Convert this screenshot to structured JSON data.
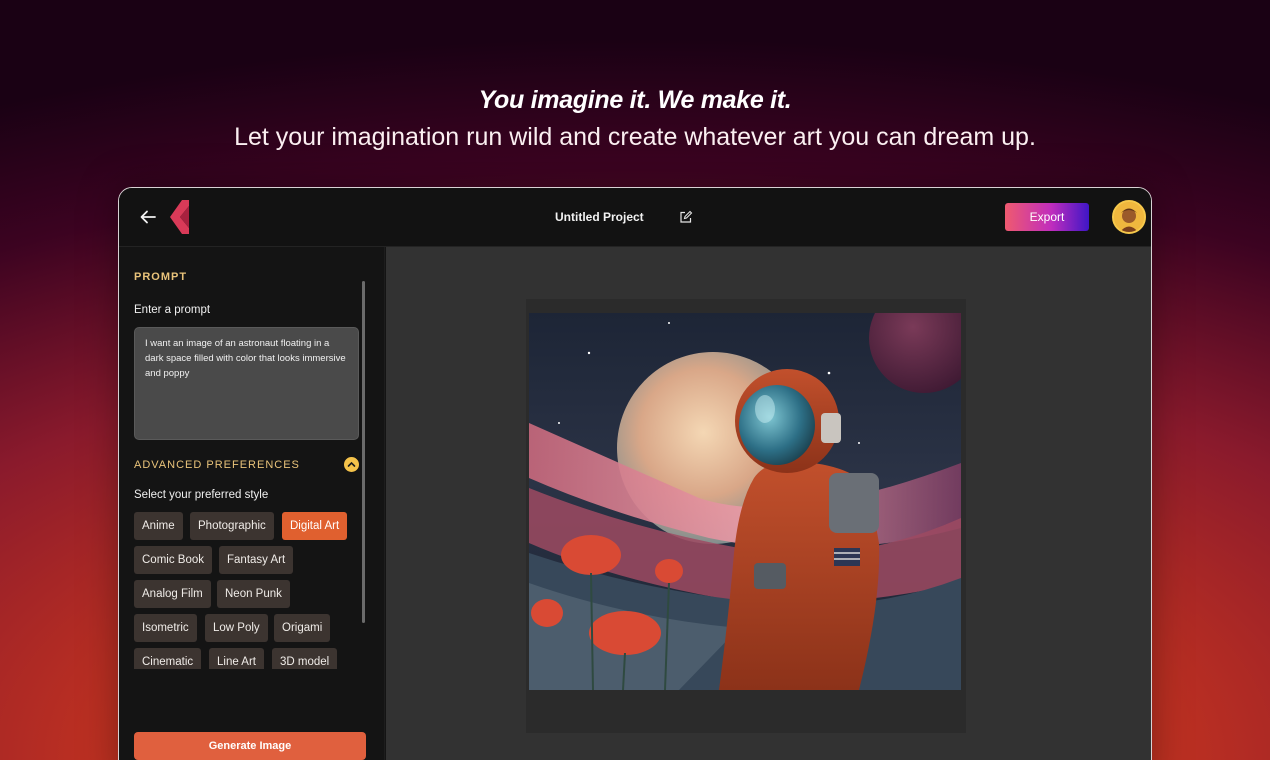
{
  "hero": {
    "title": "You imagine it. We make it.",
    "subtitle": "Let your imagination run wild and create whatever art you can dream up."
  },
  "topbar": {
    "back_icon": "arrow-left-icon",
    "logo_icon": "brand-logo-icon",
    "project_title": "Untitled Project",
    "edit_icon": "edit-icon",
    "export_label": "Export",
    "avatar": "user-avatar"
  },
  "sidebar": {
    "prompt_section": "PROMPT",
    "prompt_label": "Enter a prompt",
    "prompt_value": "I want an image of an astronaut floating in a dark space filled with color that looks immersive and poppy",
    "advanced_section": "ADVANCED PREFERENCES",
    "collapse_icon": "chevron-up-icon",
    "style_label": "Select your preferred style",
    "styles": [
      "Anime",
      "Photographic",
      "Digital Art",
      "Comic Book",
      "Fantasy Art",
      "Analog Film",
      "Neon Punk",
      "Isometric",
      "Low Poly",
      "Origami",
      "Cinematic",
      "Line Art",
      "3D model"
    ],
    "selected_style": "Digital Art",
    "generate_label": "Generate Image"
  },
  "colors": {
    "accent": "#e0602f",
    "section_label": "#e9c37a",
    "export_gradient": [
      "#ef5a6f",
      "#c02dbd",
      "#3f16c6"
    ]
  }
}
